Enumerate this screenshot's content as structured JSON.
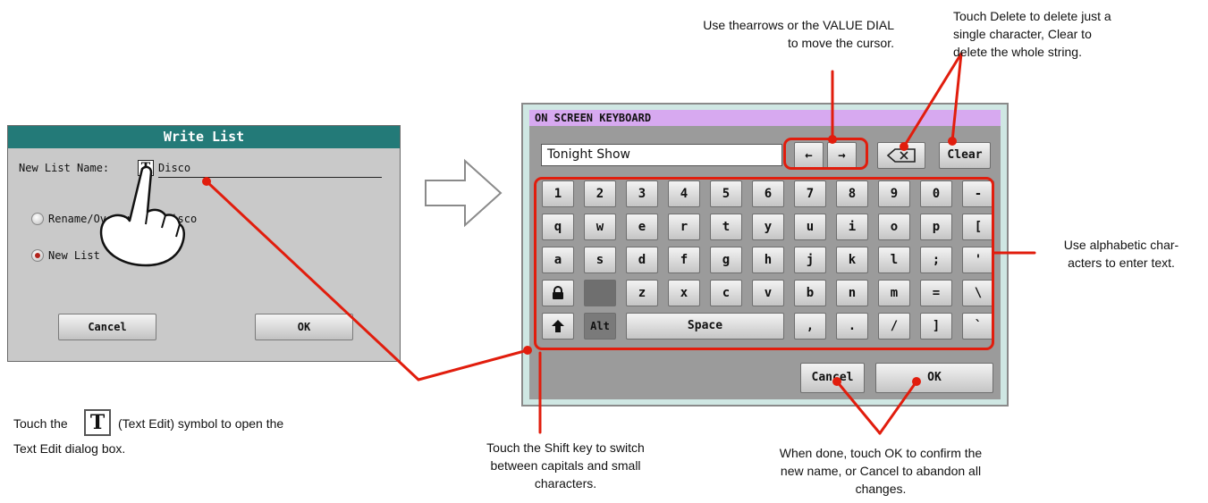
{
  "write_list": {
    "title": "Write List",
    "name_label": "New List Name:",
    "text_icon": "T",
    "name_value": "Disco",
    "option_rename": "Rename/Overwrite: Disco",
    "option_new": "New List",
    "cancel": "Cancel",
    "ok": "OK"
  },
  "keyboard": {
    "title": "ON SCREEN KEYBOARD",
    "field_value": "Tonight Show",
    "arrow_left": "←",
    "arrow_right": "→",
    "delete_icon": "⌫",
    "clear": "Clear",
    "rows": [
      [
        "1",
        "2",
        "3",
        "4",
        "5",
        "6",
        "7",
        "8",
        "9",
        "0",
        "-"
      ],
      [
        "q",
        "w",
        "e",
        "r",
        "t",
        "y",
        "u",
        "i",
        "o",
        "p",
        "["
      ],
      [
        "a",
        "s",
        "d",
        "f",
        "g",
        "h",
        "j",
        "k",
        "l",
        ";",
        "'"
      ],
      [
        "lock-icon",
        "",
        "z",
        "x",
        "c",
        "v",
        "b",
        "n",
        "m",
        "=",
        "\\"
      ],
      [
        "shift-icon",
        "Alt",
        "Space",
        ",",
        ".",
        "/",
        "]",
        "`"
      ]
    ],
    "cancel": "Cancel",
    "ok": "OK"
  },
  "annotations": {
    "arrows": "Use thearrows or the VALUE DIAL\nto move the cursor.",
    "delete": "Touch Delete to delete just a\nsingle character, Clear to\ndelete the whole string.",
    "alpha": "Use alphabetic char-\nacters to enter text.",
    "text_edit_before": "Touch the",
    "text_edit_after": "(Text Edit) symbol to open the",
    "text_edit_line2": "Text Edit dialog box.",
    "shift": "Touch the Shift key to switch\nbetween capitals and small\ncharacters.",
    "confirm": "When done, touch OK to confirm the\nnew name, or Cancel to abandon all\nchanges."
  },
  "colors": {
    "callout_red": "#e11d0d",
    "title_teal": "#237a78",
    "keyboard_title": "#d7a9f0",
    "keyboard_frame": "#cfe7e3"
  }
}
